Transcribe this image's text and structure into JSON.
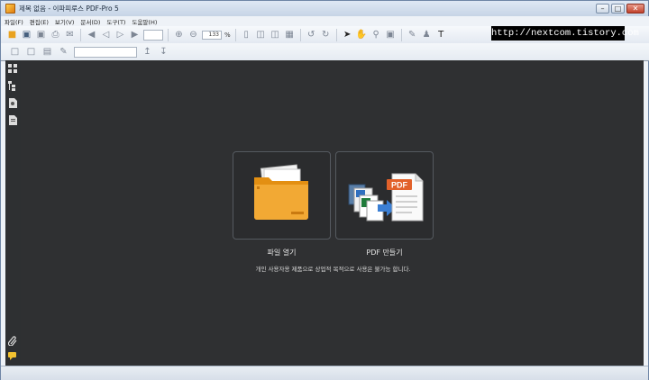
{
  "window": {
    "title": "제목 없음 - 이파피루스 PDF-Pro 5"
  },
  "window_controls": {
    "minimize": "–",
    "maximize": "□",
    "close": "✕"
  },
  "menu": [
    "파일(F)",
    "편집(E)",
    "보기(V)",
    "문서(D)",
    "도구(T)",
    "도움말(H)"
  ],
  "toolbar": {
    "zoom_value": "133",
    "zoom_unit": "%"
  },
  "watermark": "http://nextcom.tistory.com",
  "start_page": {
    "open_label": "파일 열기",
    "create_label": "PDF 만들기",
    "notice": "개인 사용자용 제품으로 상업적 목적으로 사용은 불가능 합니다.",
    "pdf_badge": "PDF"
  },
  "colors": {
    "workspace": "#2f3032",
    "card_border": "#555a60",
    "folder": "#f0a52a",
    "pdf_badge": "#e2612a"
  }
}
